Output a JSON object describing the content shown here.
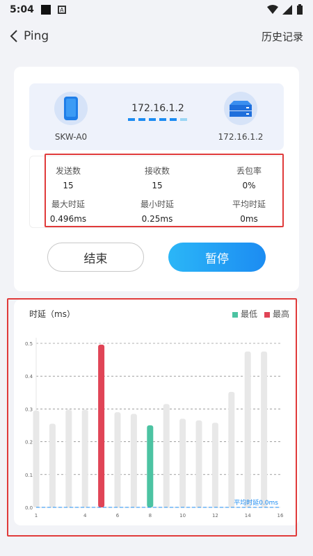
{
  "status_bar": {
    "time": "5:04",
    "badge": "A"
  },
  "header": {
    "back_label": "Ping",
    "history_label": "历史记录"
  },
  "devices": {
    "source_name": "SKW-A0",
    "target_ip_top": "172.16.1.2",
    "target_ip_bottom": "172.16.1.2",
    "source_icon": "phone-icon",
    "target_icon": "server-icon"
  },
  "stats": {
    "sent_label": "发送数",
    "sent_value": "15",
    "received_label": "接收数",
    "received_value": "15",
    "loss_label": "丢包率",
    "loss_value": "0%",
    "max_label": "最大时延",
    "max_value": "0.496ms",
    "min_label": "最小时延",
    "min_value": "0.25ms",
    "avg_label": "平均时延",
    "avg_value": "0ms"
  },
  "buttons": {
    "end_label": "结束",
    "pause_label": "暂停"
  },
  "colors": {
    "accent": "#1c8cf2",
    "min": "#4cc3a2",
    "max": "#e04456",
    "bar": "#e8e8e8"
  },
  "chart_data": {
    "type": "bar",
    "title": "时延（ms）",
    "legend": [
      "最低",
      "最高"
    ],
    "x": [
      1,
      2,
      3,
      4,
      5,
      6,
      7,
      8,
      9,
      10,
      11,
      12,
      13,
      14,
      15
    ],
    "values": [
      0.295,
      0.255,
      0.298,
      0.298,
      0.496,
      0.29,
      0.285,
      0.25,
      0.315,
      0.27,
      0.265,
      0.258,
      0.352,
      0.475,
      0.475
    ],
    "min_index": 7,
    "max_index": 4,
    "xticks": [
      1,
      4,
      6,
      8,
      10,
      12,
      14,
      16
    ],
    "yticks": [
      0.0,
      0.1,
      0.2,
      0.3,
      0.4,
      0.5
    ],
    "ylim": [
      0,
      0.5
    ],
    "xlim": [
      1,
      16
    ],
    "avg_label": "平均时延0.0ms",
    "avg_value": 0.0
  }
}
